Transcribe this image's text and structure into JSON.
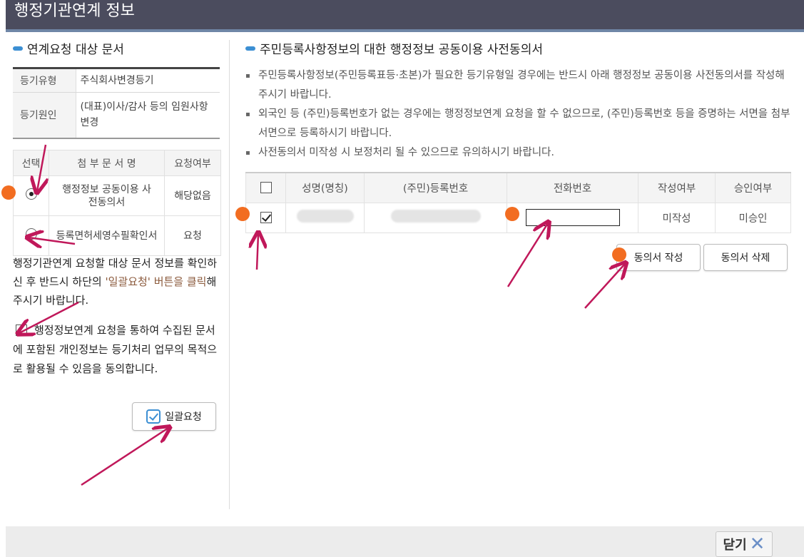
{
  "window": {
    "title": "행정기관연계 정보",
    "close_label": "닫기",
    "close_icon": "✕"
  },
  "left": {
    "section_title": "연계요청 대상 문서",
    "info": [
      {
        "label": "등기유형",
        "value": "주식회사변경등기"
      },
      {
        "label": "등기원인",
        "value": "(대표)이사/감사 등의 임원사항 변경"
      }
    ],
    "doc_table": {
      "headers": [
        "선택",
        "첨 부 문 서 명",
        "요청여부"
      ],
      "rows": [
        {
          "name": "행정정보 공동이용 사전동의서",
          "status": "해당없음",
          "selected": true
        },
        {
          "name": "등록면허세영수필확인서",
          "status": "요청",
          "selected": false
        }
      ]
    },
    "notice_pre": "행정기관연계 요청할 대상 문서 정보를 확인하신 후 반드시 하단의 ",
    "notice_hl": "'일괄요청' 버튼을 클릭",
    "notice_post": "해 주시기 바랍니다.",
    "agree_text": "행정정보연계 요청을 통하여 수집된 문서에 포함된 개인정보는 등기처리 업무의 목적으로 활용될 수 있음을 동의합니다.",
    "batch_button": "일괄요청"
  },
  "right": {
    "section_title": "주민등록사항정보의 대한 행정정보 공동이용 사전동의서",
    "bullets": [
      "주민등록사항정보(주민등록표등·초본)가 필요한 등기유형일 경우에는 반드시 아래 행정정보 공동이용 사전동의서를 작성해 주시기 바랍니다.",
      "외국인 등 (주민)등록번호가 없는 경우에는 행정정보연계 요청을 할 수 없으므로, (주민)등록번호 등을 증명하는 서면을 첨부서면으로 등록하시기 바랍니다.",
      "사전동의서 미작성 시 보정처리 될 수 있으므로 유의하시기 바랍니다."
    ],
    "table": {
      "headers": [
        "성명(명칭)",
        "(주민)등록번호",
        "전화번호",
        "작성여부",
        "승인여부"
      ],
      "row": {
        "phone": "",
        "written": "미작성",
        "approved": "미승인"
      }
    },
    "write_button": "동의서 작성",
    "delete_button": "동의서 삭제"
  },
  "colors": {
    "titlebar": "#4b4c5e",
    "accent": "#3c8fd3",
    "marker_dot": "#f26d21",
    "arrow": "#c0185a"
  }
}
